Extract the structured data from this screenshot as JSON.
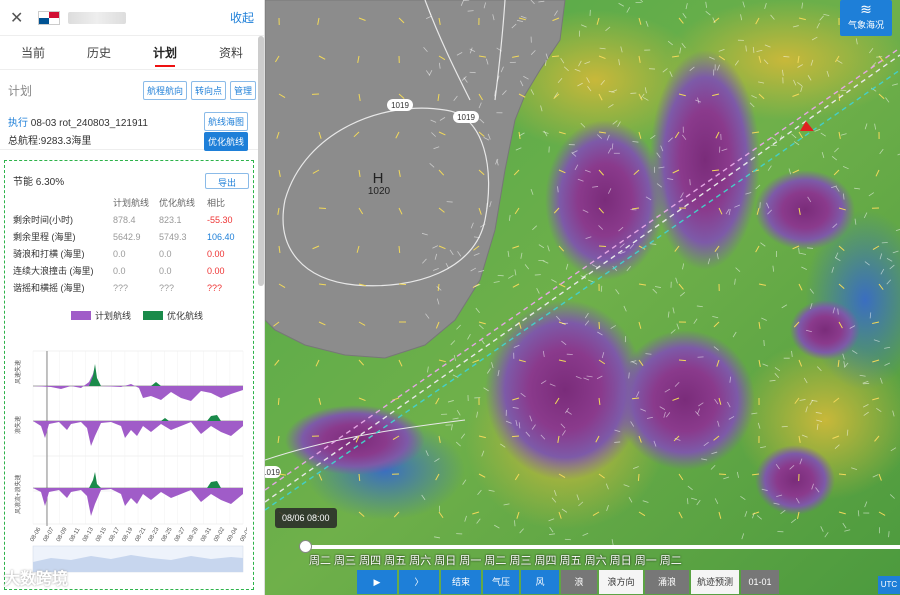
{
  "header": {
    "close_icon": "close-icon",
    "flag_icon": "panama-flag-icon",
    "collapse_label": "收起"
  },
  "tabs": [
    {
      "label": "当前",
      "active": false
    },
    {
      "label": "历史",
      "active": false
    },
    {
      "label": "计划",
      "active": true
    },
    {
      "label": "资料",
      "active": false
    }
  ],
  "plan": {
    "title": "计划",
    "buttons": [
      "航程航向",
      "转向点",
      "管理"
    ],
    "exec_label": "执行",
    "exec_value": "08-03 rot_240803_121911",
    "total_distance": "总航程:9283.3海里",
    "route_map_button": "航线海图",
    "optimize_button": "优化航线"
  },
  "savings": {
    "title": "节能 6.30%",
    "export_label": "导出",
    "columns": [
      "",
      "计划航线",
      "优化航线",
      "相比"
    ],
    "rows": [
      {
        "label": "剩余时间(小时)",
        "plan": "878.4",
        "opt": "823.1",
        "diff": "-55.30",
        "diff_type": "neg"
      },
      {
        "label": "剩余里程 (海里)",
        "plan": "5642.9",
        "opt": "5749.3",
        "diff": "106.40",
        "diff_type": "pos"
      },
      {
        "label": "骑浪和打横 (海里)",
        "plan": "0.0",
        "opt": "0.0",
        "diff": "0.00",
        "diff_type": "red"
      },
      {
        "label": "连续大浪撞击 (海里)",
        "plan": "0.0",
        "opt": "0.0",
        "diff": "0.00",
        "diff_type": "red"
      },
      {
        "label": "谐摇和横摇 (海里)",
        "plan": "???",
        "opt": "???",
        "diff": "???",
        "diff_type": "red"
      }
    ],
    "legend": [
      {
        "label": "计划航线",
        "color": "#a05cc8"
      },
      {
        "label": "优化航线",
        "color": "#1a8a4a"
      }
    ]
  },
  "mini_charts": {
    "y_labels": [
      "风速失速",
      "浪失速",
      "风浪流+浪失速"
    ],
    "x_labels": [
      "08-06",
      "08-07",
      "08-09",
      "08-11",
      "08-13",
      "08-15",
      "08-17",
      "08-19",
      "08-21",
      "08-23",
      "08-25",
      "08-27",
      "08-29",
      "08-31",
      "09-02",
      "09-04",
      "09-06"
    ]
  },
  "map": {
    "weather_button": "气象海况",
    "pressure_high_letter": "H",
    "pressure_high_value": "1020",
    "isobar_labels": [
      "1019",
      "1019",
      "1019"
    ],
    "time_tip": "08/06 08:00",
    "timeline_ticks": "周二 周三 周四 周五 周六 周日 周一 周二 周三 周四 周五 周六 周日 周一 周二",
    "controls": [
      {
        "label": "▶",
        "icon": "play-icon",
        "style": "blue"
      },
      {
        "label": "〉",
        "icon": "next-icon",
        "style": "blue"
      },
      {
        "label": "结束",
        "style": "blue"
      },
      {
        "label": "气压",
        "style": "blue"
      },
      {
        "label": "风",
        "style": "blue"
      },
      {
        "label": "浪",
        "style": "gray"
      },
      {
        "label": "浪方向",
        "style": "white"
      },
      {
        "label": "涌浪",
        "style": "gray"
      },
      {
        "label": "航迹预测",
        "style": "white"
      },
      {
        "label": "01-01",
        "style": "gray"
      }
    ],
    "utc_label": "UTC"
  },
  "watermark": "大数跨境"
}
